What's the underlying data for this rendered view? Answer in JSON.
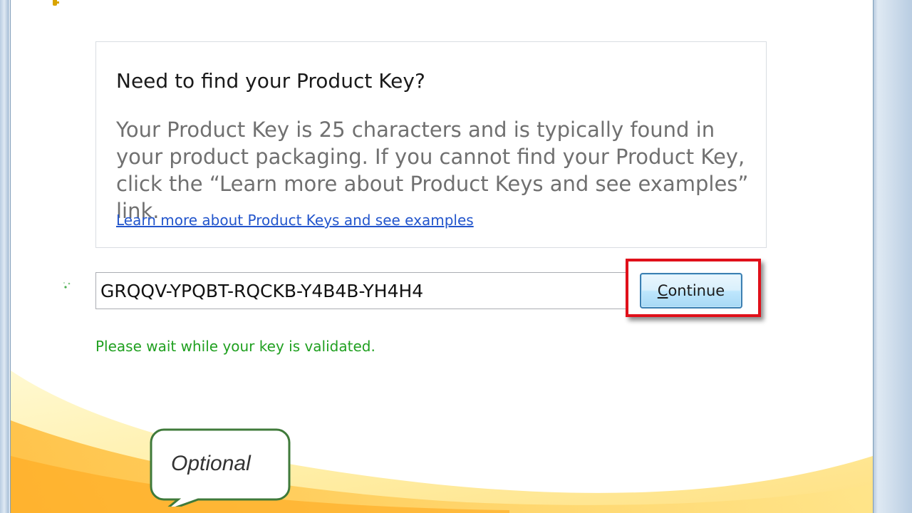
{
  "info": {
    "title": "Need to find your Product Key?",
    "body": "Your Product Key is 25 characters and is typically found in your product packaging. If you cannot find your Product Key, click the “Learn more about Product Keys and see examples” link.",
    "link": "Learn more about Product Keys and see examples"
  },
  "product_key": {
    "value": "GRQQV-YPQBT-RQCKB-Y4B4B-YH4H4"
  },
  "continue_button": {
    "label_first": "C",
    "label_rest": "ontinue"
  },
  "status": {
    "text": "Please wait while your key is validated."
  },
  "callout": {
    "text": "Optional"
  },
  "colors": {
    "highlight": "#e0101a",
    "status_green": "#20a020",
    "link_blue": "#2255cc",
    "callout_border": "#3f7a3a"
  }
}
